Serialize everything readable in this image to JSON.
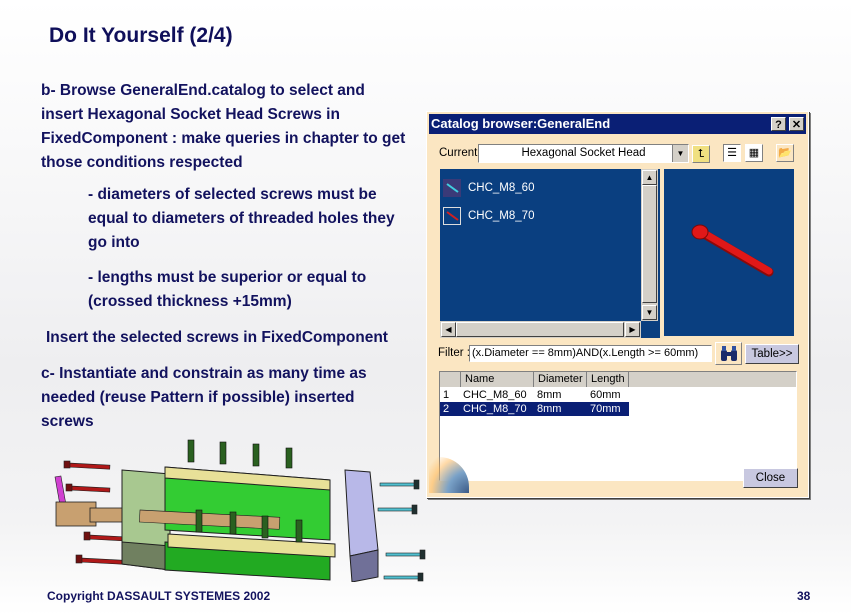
{
  "slide": {
    "title": "Do It Yourself (2/4)",
    "para_b": "b- Browse GeneralEnd.catalog to select and insert Hexagonal Socket Head Screws in FixedComponent : make queries in chapter to get those conditions respected",
    "bullet_1": "- diameters of selected screws must be equal to diameters of threaded holes they go into",
    "bullet_2": "- lengths must be superior or equal to (crossed thickness +15mm)",
    "insert_text": "Insert the selected screws in FixedComponent",
    "para_c": "c- Instantiate and constrain as many time as needed (reuse Pattern if possible) inserted screws",
    "copyright": "Copyright DASSAULT SYSTEMES 2002",
    "page_number": "38"
  },
  "dialog": {
    "title": "Catalog browser:GeneralEnd",
    "help_label": "?",
    "close_x_label": "✕",
    "current_label": "Current :",
    "current_value": "Hexagonal Socket Head",
    "icons": [
      "up-chapter-icon",
      "list-view-icon",
      "detail-view-icon",
      "open-folder-icon"
    ],
    "list_items": [
      {
        "name": "CHC_M8_60",
        "thumb_color": "#40d0e0"
      },
      {
        "name": "CHC_M8_70",
        "thumb_color": "#d02020"
      }
    ],
    "filter_label": "Filter :",
    "filter_value": "(x.Diameter == 8mm)AND(x.Length >= 60mm)",
    "table_button": "Table>>",
    "table": {
      "columns": [
        "",
        "Name",
        "Diameter",
        "Length"
      ],
      "rows": [
        {
          "index": "1",
          "name": "CHC_M8_60",
          "diameter": "8mm",
          "length": "60mm",
          "selected": false
        },
        {
          "index": "2",
          "name": "CHC_M8_70",
          "diameter": "8mm",
          "length": "70mm",
          "selected": true
        }
      ]
    },
    "close_button": "Close",
    "colors": {
      "titlebar": "#0a1f75",
      "panel": "#fbe6c2",
      "list_bg": "#0a3f80",
      "preview_screw": "#e01818"
    }
  }
}
